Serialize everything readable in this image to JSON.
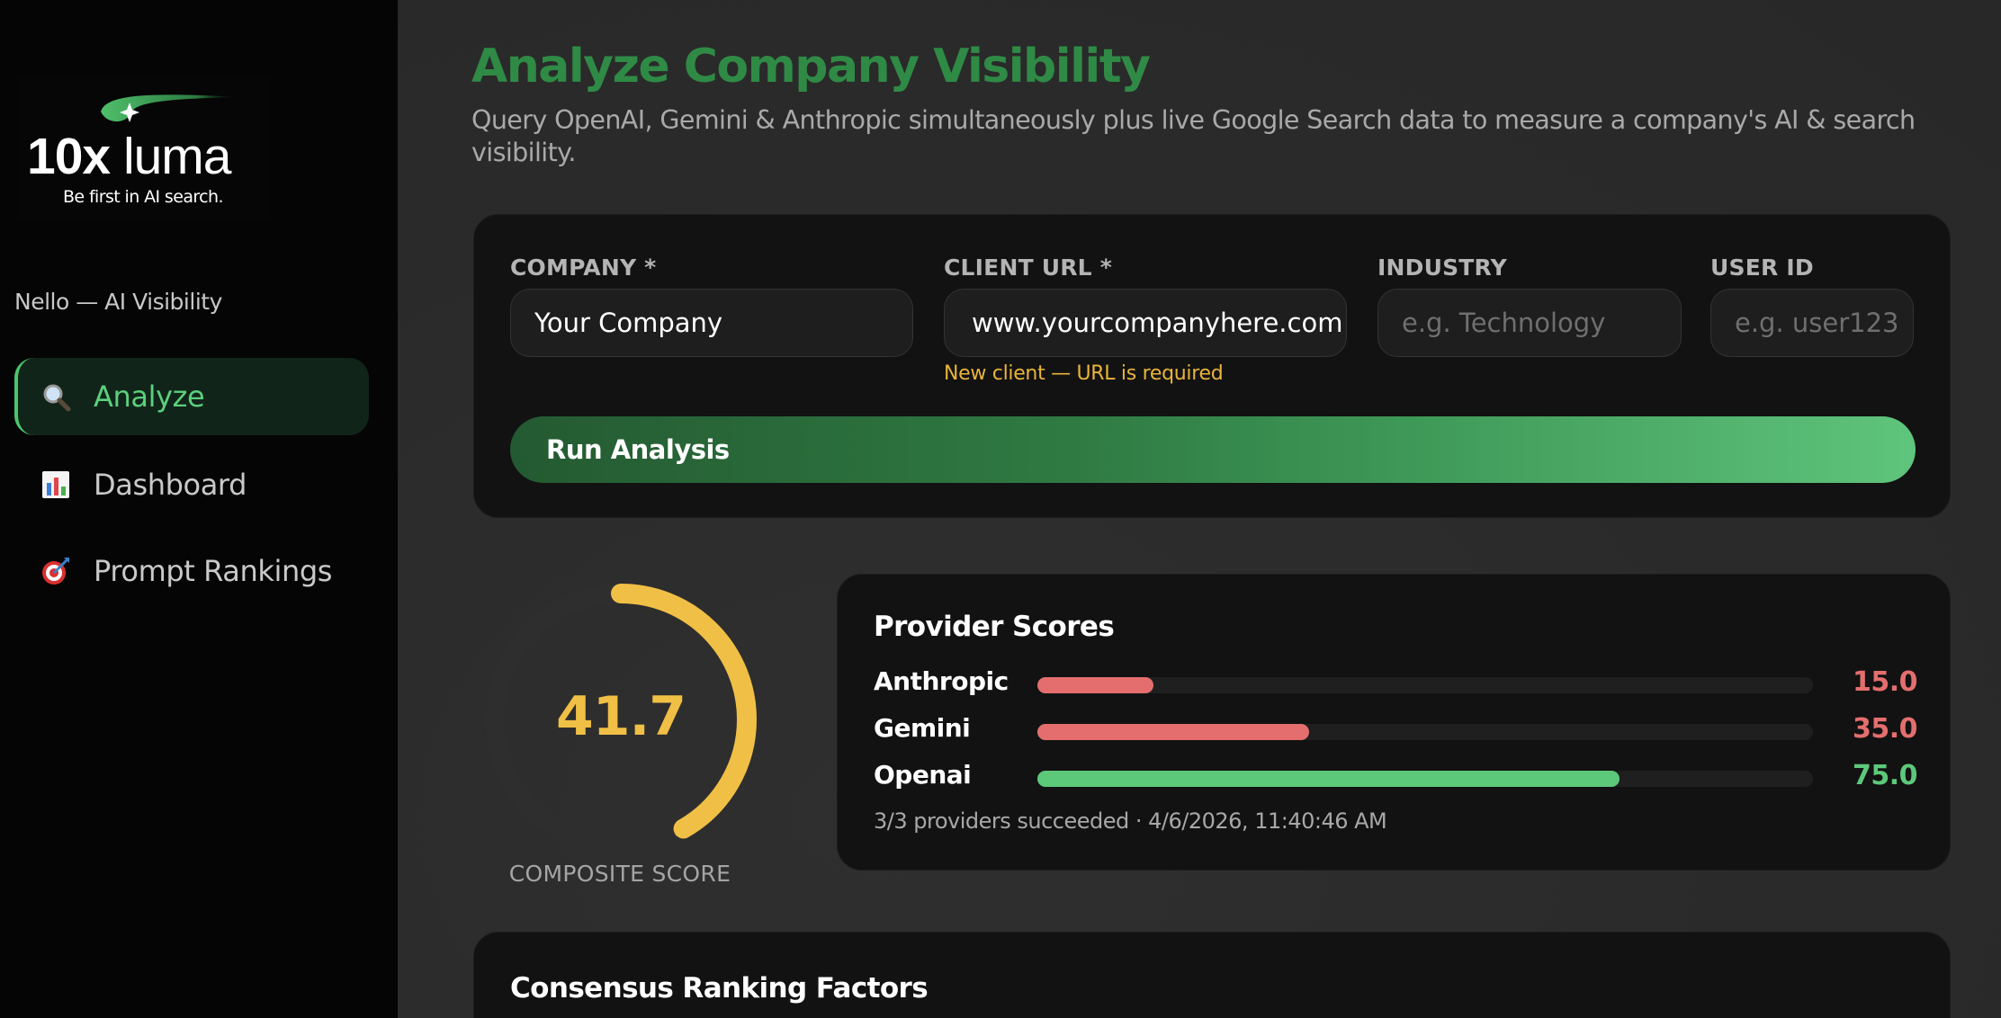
{
  "sidebar": {
    "logo_word_bold": "10x",
    "logo_word_rest": " luma",
    "logo_tagline": "Be first in AI search.",
    "workspace": "Nello — AI Visibility",
    "nav": [
      {
        "label": "Analyze",
        "icon": "magnifier-icon",
        "active": true
      },
      {
        "label": "Dashboard",
        "icon": "bar-chart-icon",
        "active": false
      },
      {
        "label": "Prompt Rankings",
        "icon": "target-icon",
        "active": false
      }
    ]
  },
  "header": {
    "title": "Analyze Company Visibility",
    "subtitle": "Query OpenAI, Gemini & Anthropic simultaneously plus live Google Search data to measure a company's AI & search visibility."
  },
  "form": {
    "company": {
      "label": "COMPANY *",
      "value": "Your Company",
      "placeholder": ""
    },
    "client_url": {
      "label": "CLIENT URL *",
      "value": "www.yourcompanyhere.com",
      "placeholder": ""
    },
    "industry": {
      "label": "INDUSTRY",
      "value": "",
      "placeholder": "e.g. Technology"
    },
    "user_id": {
      "label": "USER ID",
      "value": "",
      "placeholder": "e.g. user123"
    },
    "url_hint": "New client — URL is required",
    "run_label": "Run Analysis"
  },
  "composite": {
    "value": "41.7",
    "fraction": 0.417,
    "caption": "COMPOSITE SCORE"
  },
  "provider_scores": {
    "title": "Provider Scores",
    "providers": [
      {
        "name": "Anthropic",
        "score": "15.0",
        "fraction": 0.15
      },
      {
        "name": "Gemini",
        "score": "35.0",
        "fraction": 0.35
      },
      {
        "name": "Openai",
        "score": "75.0",
        "fraction": 0.75
      }
    ],
    "meta": "3/3 providers succeeded · 4/6/2026, 11:40:46 AM"
  },
  "factors": {
    "title": "Consensus Ranking Factors"
  },
  "colors": {
    "brand_green": "#2f8a45",
    "active_nav": "#5bd07c",
    "gauge": "#f0bf45",
    "low_score": "#e46e6e",
    "high_score": "#5cc97a",
    "hint": "#e9b43a"
  }
}
